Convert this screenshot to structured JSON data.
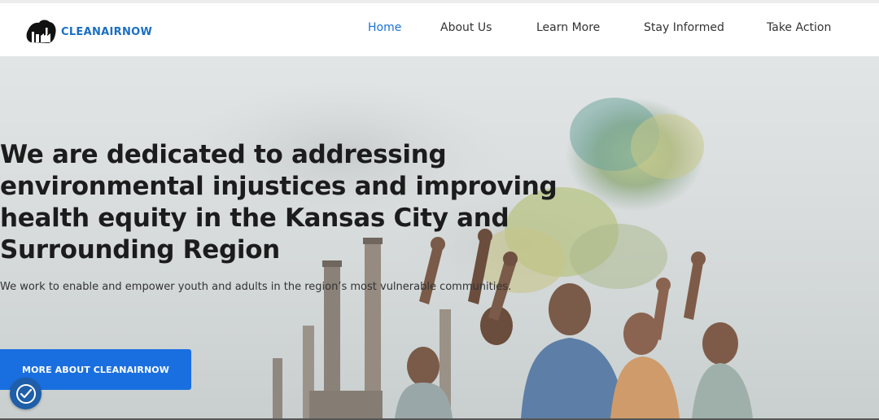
{
  "brand": {
    "name": "CLEANAIRNOW",
    "color": "#1a6fc4"
  },
  "nav": {
    "items": [
      {
        "label": "Home",
        "active": true
      },
      {
        "label": "About Us"
      },
      {
        "label": "Learn More"
      },
      {
        "label": "Stay Informed"
      },
      {
        "label": "Take Action"
      }
    ],
    "active_color": "#1a72d0"
  },
  "hero": {
    "headline": "We are dedicated to addressing environmental injustices and improving health equity in the Kansas City and Surrounding Region",
    "subtext": "We work to enable and empower youth and adults in the region’s most vulnerable communities.",
    "cta_label": "MORE ABOUT CLEANAIRNOW",
    "cta_color": "#1a6fe0"
  },
  "accessibility": {
    "icon": "accessibility-icon"
  }
}
